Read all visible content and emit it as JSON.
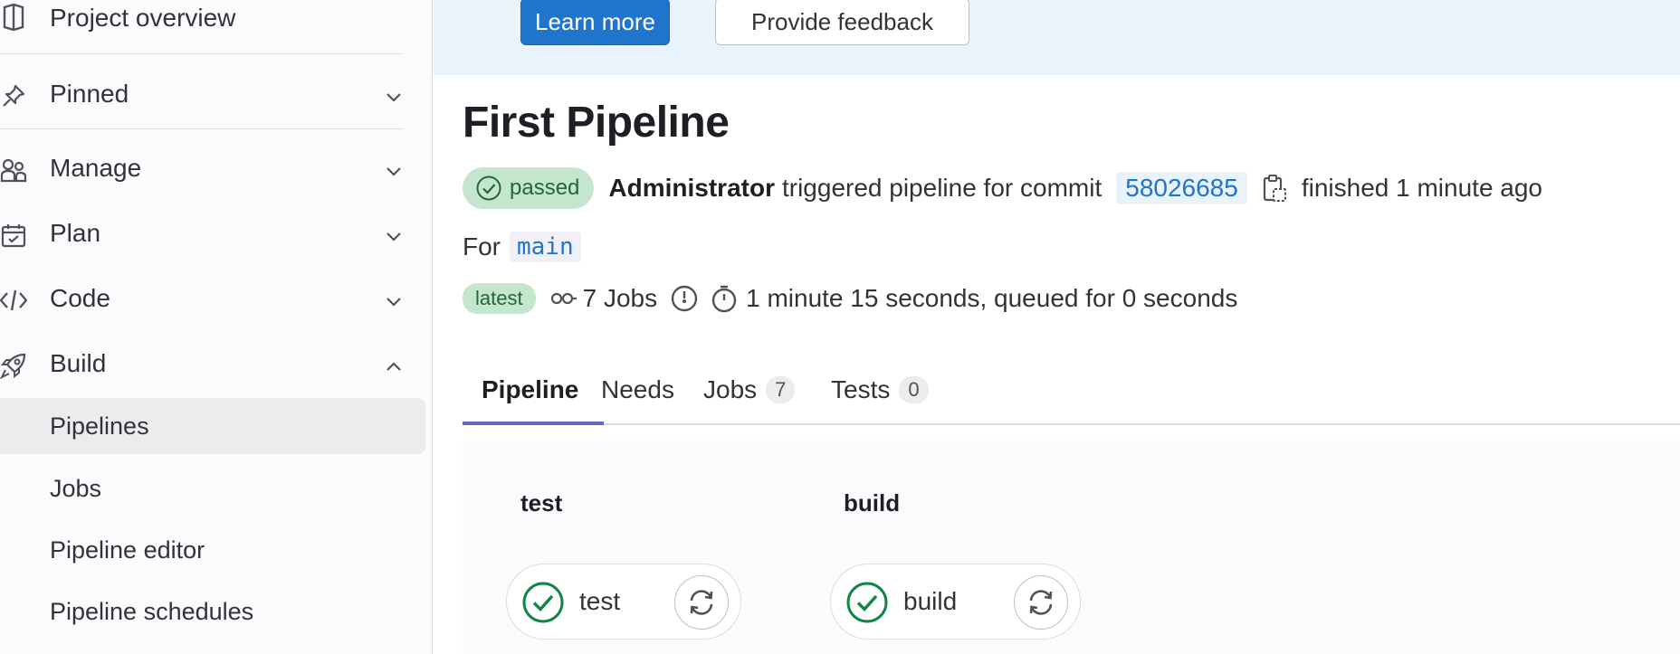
{
  "sidebar": {
    "project_overview": "Project overview",
    "items": [
      {
        "label": "Pinned",
        "icon": "pin-icon",
        "expanded": false
      },
      {
        "label": "Manage",
        "icon": "users-icon",
        "expanded": false
      },
      {
        "label": "Plan",
        "icon": "calendar-icon",
        "expanded": false
      },
      {
        "label": "Code",
        "icon": "code-icon",
        "expanded": false
      },
      {
        "label": "Build",
        "icon": "rocket-icon",
        "expanded": true
      }
    ],
    "build_subitems": [
      {
        "label": "Pipelines",
        "active": true
      },
      {
        "label": "Jobs",
        "active": false
      },
      {
        "label": "Pipeline editor",
        "active": false
      },
      {
        "label": "Pipeline schedules",
        "active": false
      }
    ]
  },
  "banner": {
    "learn_more": "Learn more",
    "feedback": "Provide feedback"
  },
  "pipeline": {
    "title": "First Pipeline",
    "status": "passed",
    "author": "Administrator",
    "triggered_text": "triggered pipeline for commit",
    "commit": "58026685",
    "finished": "finished 1 minute ago",
    "for_label": "For",
    "branch": "main",
    "latest_badge": "latest",
    "jobs_count_text": "7 Jobs",
    "duration_text": "1 minute 15 seconds, queued for 0 seconds"
  },
  "tabs": [
    {
      "label": "Pipeline",
      "active": true
    },
    {
      "label": "Needs",
      "active": false
    },
    {
      "label": "Jobs",
      "count": "7",
      "active": false
    },
    {
      "label": "Tests",
      "count": "0",
      "active": false
    }
  ],
  "stages": [
    {
      "title": "test",
      "job": "test",
      "status": "success"
    },
    {
      "title": "build",
      "job": "build",
      "status": "success"
    }
  ],
  "colors": {
    "primary": "#1f75cb",
    "success": "#108548",
    "success_bg": "#c3e6cd",
    "tab_underline": "#6666c4",
    "banner_bg": "#e9f3fc"
  }
}
